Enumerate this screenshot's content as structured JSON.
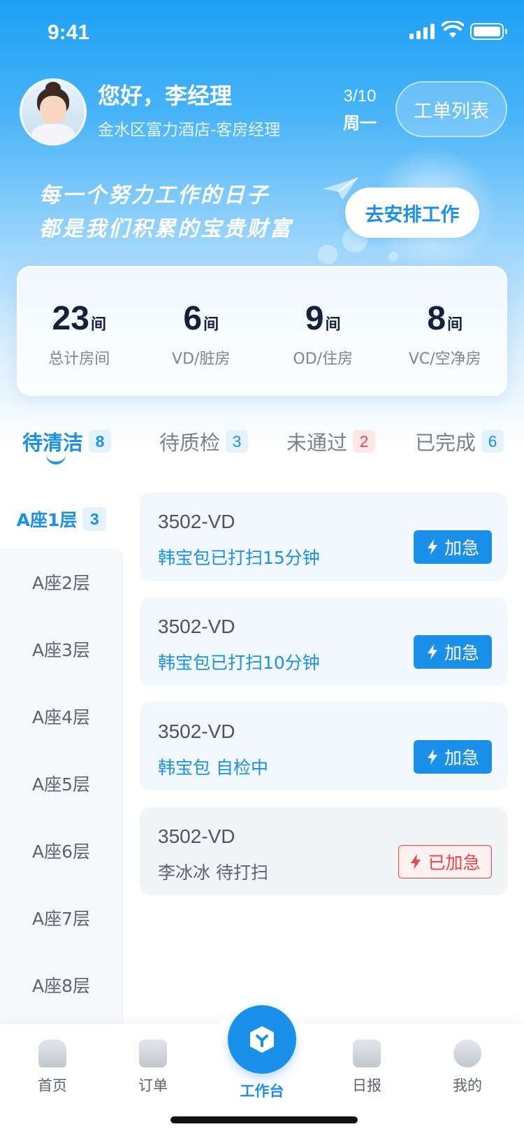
{
  "status_bar": {
    "time": "9:41"
  },
  "header": {
    "greeting": "您好，李经理",
    "subtitle": "金水区富力酒店-客房经理",
    "date": "3/10",
    "weekday": "周一",
    "orders_button": "工单列表"
  },
  "banner": {
    "slogan_line1": "每一个努力工作的日子",
    "slogan_line2": "都是我们积累的宝贵财富",
    "arrange_button": "去安排工作"
  },
  "stats": [
    {
      "value": "23",
      "unit": "间",
      "label": "总计房间"
    },
    {
      "value": "6",
      "unit": "间",
      "label": "VD/脏房"
    },
    {
      "value": "9",
      "unit": "间",
      "label": "OD/住房"
    },
    {
      "value": "8",
      "unit": "间",
      "label": "VC/空净房"
    }
  ],
  "tabs": [
    {
      "label": "待清洁",
      "count": "8"
    },
    {
      "label": "待质检",
      "count": "3"
    },
    {
      "label": "未通过",
      "count": "2"
    },
    {
      "label": "已完成",
      "count": "6"
    }
  ],
  "floors": {
    "active": {
      "label": "A座1层",
      "count": "3"
    },
    "items": [
      "A座2层",
      "A座3层",
      "A座4层",
      "A座5层",
      "A座6层",
      "A座7层",
      "A座8层"
    ]
  },
  "rooms": [
    {
      "title": "3502-VD",
      "desc": "韩宝包已打扫15分钟",
      "action": "加急"
    },
    {
      "title": "3502-VD",
      "desc": "韩宝包已打扫10分钟",
      "action": "加急"
    },
    {
      "title": "3502-VD",
      "desc": "韩宝包 自检中",
      "action": "加急"
    },
    {
      "title": "3502-VD",
      "desc": "李冰冰 待打扫",
      "action": "已加急"
    }
  ],
  "bottom_nav": {
    "home": "首页",
    "orders": "订单",
    "workbench": "工作台",
    "daily": "日报",
    "mine": "我的"
  },
  "colors": {
    "accent": "#1b90ea",
    "danger": "#ea4545"
  }
}
